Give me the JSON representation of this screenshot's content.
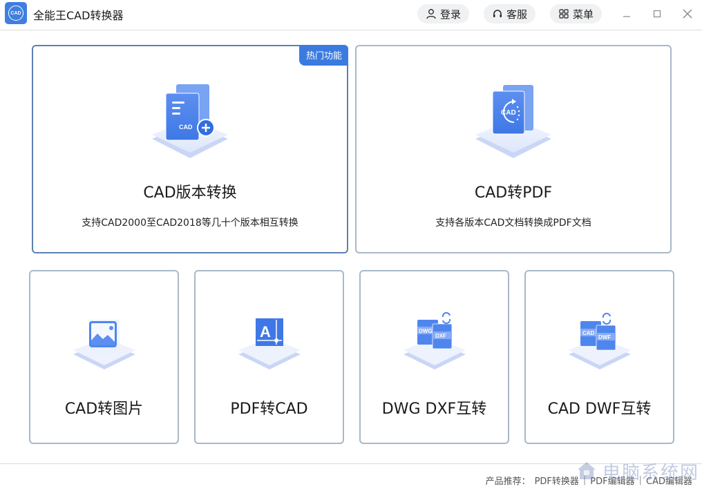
{
  "app": {
    "title": "全能王CAD转换器",
    "logo_text": "CAD"
  },
  "header": {
    "login_label": "登录",
    "support_label": "客服",
    "menu_label": "菜单"
  },
  "colors": {
    "accent": "#3b7be0",
    "card_border": "#a7b8c8",
    "hot_card_border": "#5b80b0"
  },
  "main_cards": [
    {
      "title": "CAD版本转换",
      "desc": "支持CAD2000至CAD2018等几十个版本相互转换",
      "badge": "热门功能",
      "icon": "cad-add-document-icon",
      "icon_text": "CAD"
    },
    {
      "title": "CAD转PDF",
      "desc": "支持各版本CAD文档转换成PDF文档",
      "icon": "cad-convert-cycle-icon",
      "icon_text": "CAD"
    }
  ],
  "small_cards": [
    {
      "title": "CAD转图片",
      "icon": "image-icon"
    },
    {
      "title": "PDF转CAD",
      "icon": "text-cad-icon",
      "icon_text": "A"
    },
    {
      "title": "DWG DXF互转",
      "icon": "dwg-dxf-swap-icon",
      "icon_text_a": "DWG",
      "icon_text_b": "DXF"
    },
    {
      "title": "CAD DWF互转",
      "icon": "cad-dwf-swap-icon",
      "icon_text_a": "CAD",
      "icon_text_b": "DWF"
    }
  ],
  "footer": {
    "label": "产品推荐：",
    "links": [
      "PDF转换器",
      "PDF编辑器",
      "CAD编辑器"
    ],
    "separator": "|"
  },
  "watermark": {
    "text": "电脑系统网"
  }
}
